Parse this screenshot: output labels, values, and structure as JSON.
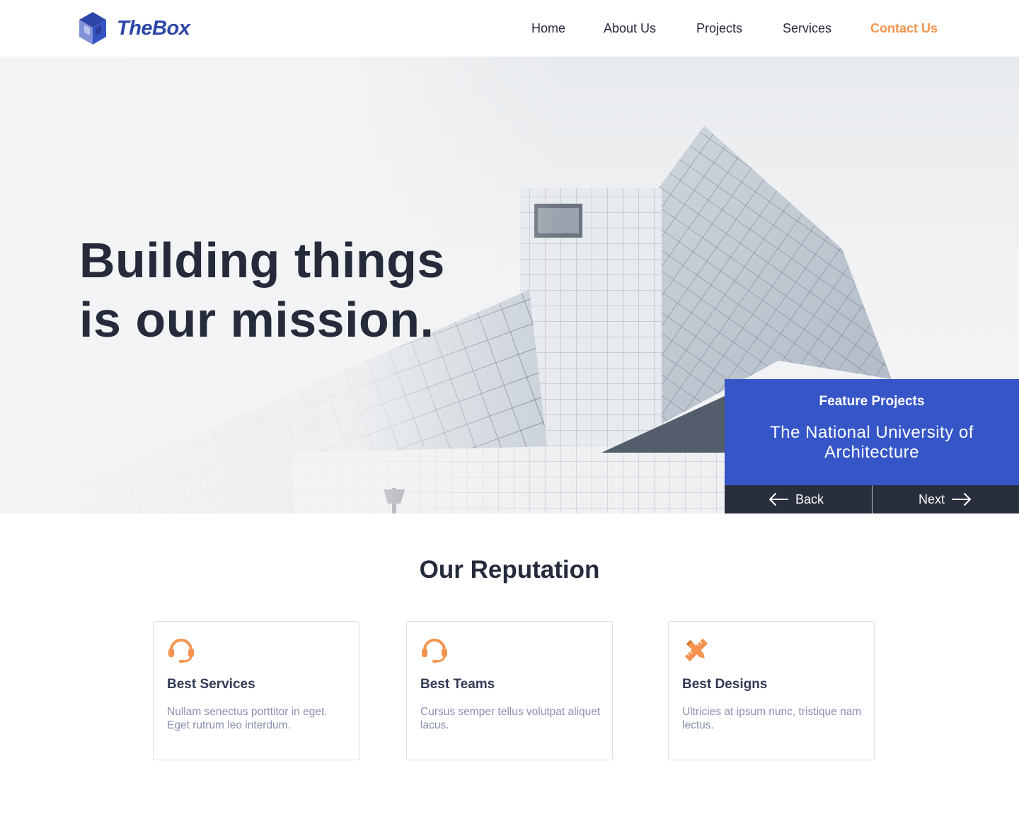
{
  "brand": {
    "name": "TheBox",
    "logo_icon": "cube-logo-icon",
    "color": "#2d46a8"
  },
  "nav": {
    "items": [
      "Home",
      "About Us",
      "Projects",
      "Services",
      "Contact Us"
    ],
    "active": "Contact Us",
    "active_color": "#f4944f"
  },
  "hero": {
    "title_line1": "Building things",
    "title_line2": "is our mission.",
    "image": "modern glass building photograph"
  },
  "feature": {
    "label": "Feature Projects",
    "name": "The National University of Architecture",
    "back_label": "Back",
    "next_label": "Next",
    "back_icon": "arrow-left-icon",
    "next_icon": "arrow-right-icon",
    "panel_color": "#3656c8",
    "nav_color": "#292e3d"
  },
  "reputation": {
    "title": "Our Reputation",
    "accent_color": "#f4944f",
    "cards": [
      {
        "icon": "headset-icon",
        "title": "Best Services",
        "text": "Nullam senectus porttitor in eget. Eget rutrum leo interdum."
      },
      {
        "icon": "headset-icon",
        "title": "Best Teams",
        "text": "Cursus semper tellus volutpat aliquet lacus."
      },
      {
        "icon": "pencil-ruler-icon",
        "title": "Best Designs",
        "text": "Ultricies at ipsum nunc, tristique nam lectus."
      }
    ]
  }
}
